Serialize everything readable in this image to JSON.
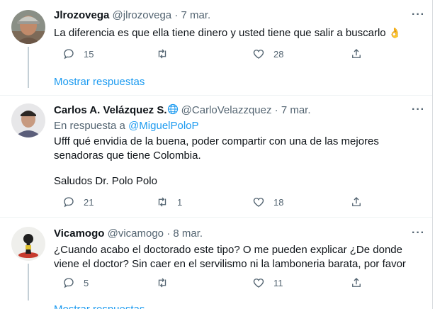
{
  "tweets": [
    {
      "name": "Jlrozovega",
      "handle": "@jlrozovega",
      "sep": "·",
      "date": "7 mar.",
      "text": "La diferencia es que ella tiene dinero y usted tiene que salir a buscarlo",
      "emoji": "👌",
      "replies": "15",
      "retweets": "",
      "likes": "28",
      "show_replies": "Mostrar respuestas"
    },
    {
      "name": "Carlos A. Velázquez S.",
      "handle": "@CarloVelazzquez",
      "sep": "·",
      "date": "7 mar.",
      "reply_prefix": "En respuesta a",
      "reply_to": "@MiguelPoloP",
      "text_line1": "Ufff qué envidia de la buena, poder compartir con una de las mejores",
      "text_line2": "senadoras que tiene Colombia.",
      "text_line3": "Saludos Dr. Polo Polo",
      "replies": "21",
      "retweets": "1",
      "likes": "18"
    },
    {
      "name": "Vicamogo",
      "handle": "@vicamogo",
      "sep": "·",
      "date": "8 mar.",
      "text_line1": "¿Cuando acabo el doctorado este tipo? O me pueden explicar ¿De donde",
      "text_line2": "viene el doctor? Sin caer en el servilismo ni la lamboneria barata, por favor",
      "replies": "5",
      "retweets": "",
      "likes": "11",
      "show_replies": "Mostrar respuestas"
    }
  ],
  "icons": {
    "more": "more-horizontal-icon",
    "reply": "reply-bubble-icon",
    "retweet": "retweet-icon",
    "like": "heart-icon",
    "share": "share-icon",
    "verified_globe": "globe-icon"
  },
  "colors": {
    "link": "#1d9bf0",
    "secondary": "#536471",
    "divider": "#eff3f4",
    "thread": "#c4cfd6"
  }
}
